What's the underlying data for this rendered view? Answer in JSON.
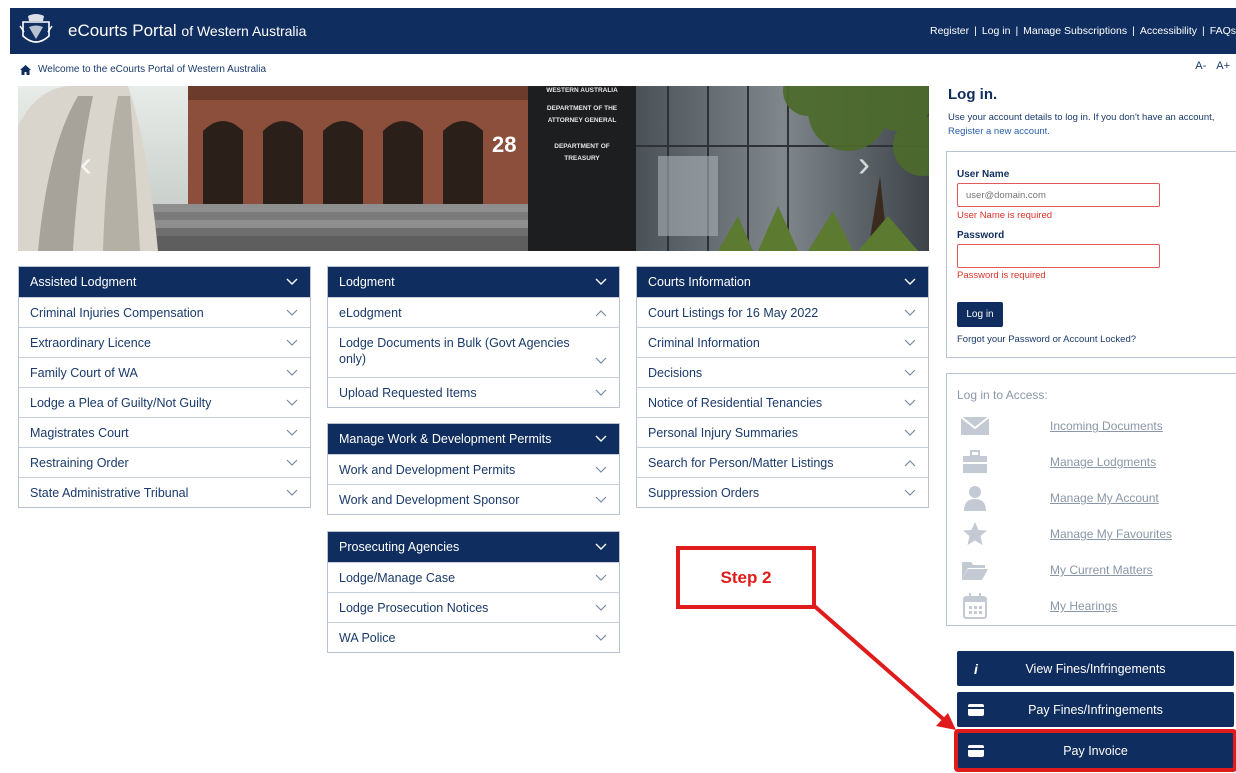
{
  "header": {
    "brand_main": "eCourts Portal",
    "brand_sub": "of Western Australia",
    "links": [
      "Register",
      "Log in",
      "Manage Subscriptions",
      "Accessibility",
      "FAQs"
    ]
  },
  "welcome_text": "Welcome to the eCourts Portal of Western Australia",
  "font_controls": [
    "A-",
    "A+"
  ],
  "hero": {
    "building_number": "28",
    "sign_lines": [
      "WESTERN AUSTRALIA",
      "DEPARTMENT OF THE",
      "ATTORNEY GENERAL",
      "DEPARTMENT OF",
      "TREASURY"
    ]
  },
  "panels": {
    "assisted": {
      "title": "Assisted Lodgment",
      "items": [
        "Criminal Injuries Compensation",
        "Extraordinary Licence",
        "Family Court of WA",
        "Lodge a Plea of Guilty/Not Guilty",
        "Magistrates Court",
        "Restraining Order",
        "State Administrative Tribunal"
      ]
    },
    "lodgment": {
      "title": "Lodgment",
      "items": [
        "eLodgment",
        "Lodge Documents in Bulk (Govt Agencies only)",
        "Upload Requested Items"
      ]
    },
    "permits": {
      "title": "Manage Work & Development Permits",
      "items": [
        "Work and Development Permits",
        "Work and Development Sponsor"
      ]
    },
    "prosecuting": {
      "title": "Prosecuting Agencies",
      "items": [
        "Lodge/Manage Case",
        "Lodge Prosecution Notices",
        "WA Police"
      ]
    },
    "courts": {
      "title": "Courts Information",
      "items": [
        "Court Listings for 16 May 2022",
        "Criminal Information",
        "Decisions",
        "Notice of Residential Tenancies",
        "Personal Injury Summaries",
        "Search for Person/Matter Listings",
        "Suppression Orders"
      ]
    }
  },
  "login": {
    "title": "Log in.",
    "desc_line1": "Use your account details to log in. If you don't have an account,",
    "register_link": "Register a new account.",
    "username_label": "User Name",
    "username_placeholder": "user@domain.com",
    "username_error": "User Name is required",
    "password_label": "Password",
    "password_error": "Password is required",
    "button": "Log in",
    "forgot": "Forgot your Password or Account Locked?"
  },
  "access": {
    "title": "Log in to Access:",
    "items": [
      "Incoming Documents",
      "Manage Lodgments",
      "Manage My Account",
      "Manage My Favourites",
      "My Current Matters",
      "My Hearings"
    ]
  },
  "actions": [
    "View Fines/Infringements",
    "Pay Fines/Infringements",
    "Pay Invoice"
  ],
  "annotation": {
    "label": "Step 2",
    "color": "#e01b1b"
  },
  "colors": {
    "navy": "#0f2d5e",
    "text": "#1a3a6b",
    "error": "#d9342b"
  }
}
